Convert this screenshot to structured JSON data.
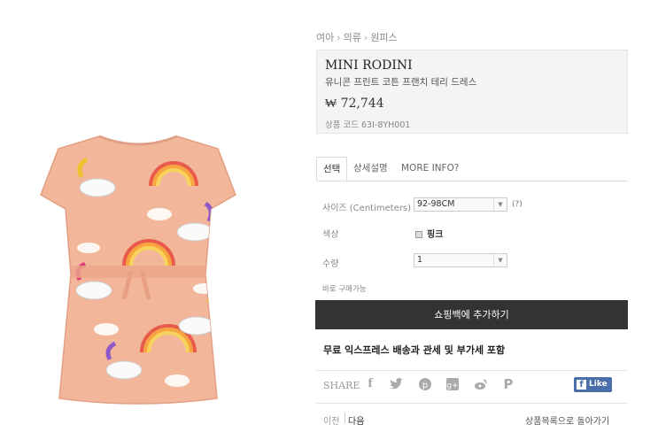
{
  "breadcrumb": [
    "여아",
    "의류",
    "원피스"
  ],
  "product": {
    "brand": "MINI RODINI",
    "name": "유니콘 프린트 코튼 프랜치 테리 드레스",
    "price": "₩ 72,744",
    "code": "상품 코드 63I-8YH001"
  },
  "tabs": [
    "선택",
    "상세설명",
    "MORE INFO?"
  ],
  "options": {
    "size_label": "사이즈 (Centimeters)",
    "size_value": "92-98CM",
    "size_help": "(?)",
    "color_label": "색상",
    "color_value": "핑크",
    "qty_label": "수량",
    "qty_value": "1",
    "buy_note": "바로 구매가능"
  },
  "add_to_cart": "쇼핑백에 추가하기",
  "shipping_note": "무료 익스프레스 배송과 관세 및 부가세 포함",
  "share": {
    "label": "SHARE",
    "icons": [
      "facebook-icon",
      "twitter-icon",
      "pinterest-icon",
      "google-plus-icon",
      "weibo-icon",
      "p-icon"
    ],
    "like_label": "Like"
  },
  "nav": {
    "prev": "이전",
    "next": "다음",
    "back": "상품목록으로 돌아가기"
  },
  "colors": {
    "cart_button": "#333333",
    "dress_base": "#f2b79a",
    "facebook": "#4a6ea9"
  }
}
